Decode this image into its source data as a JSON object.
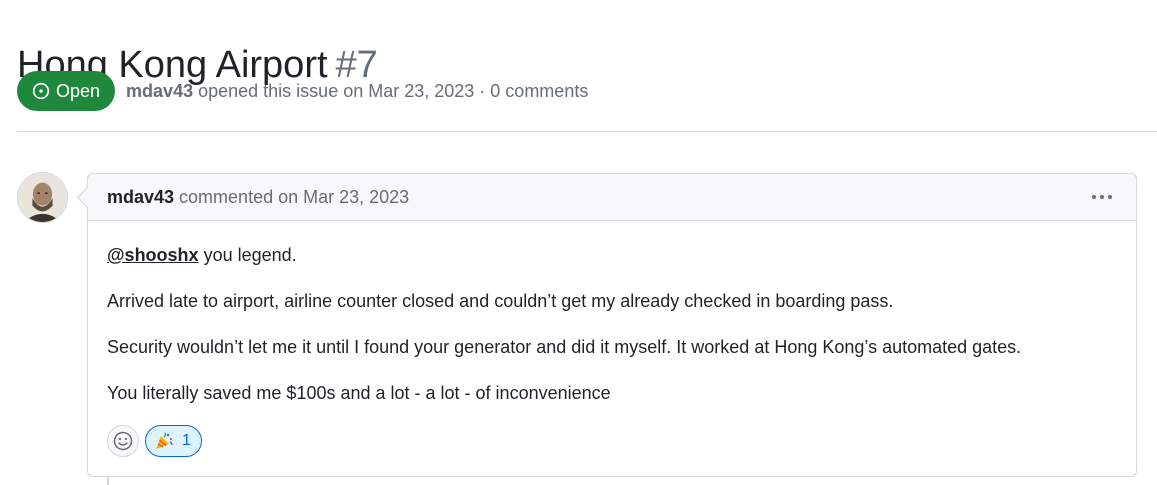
{
  "issue": {
    "title": "Hong Kong Airport",
    "number": "#7",
    "state_label": "Open",
    "author": "mdav43",
    "meta_text": "opened this issue on Mar 23, 2023 · 0 comments"
  },
  "comment": {
    "author": "mdav43",
    "meta_text": "commented on Mar 23, 2023",
    "mention": "@shooshx",
    "line1_rest": " you legend.",
    "line2": "Arrived late to airport, airline counter closed and couldn’t get my already checked in boarding pass.",
    "line3": "Security wouldn’t let me it until I found your generator and did it myself. It worked at Hong Kong’s automated gates.",
    "line4": "You literally saved me $100s and a lot - a lot - of inconvenience",
    "reactions": [
      {
        "emoji": "tada",
        "count": "1"
      }
    ]
  },
  "icons": {
    "state": "issue-opened-icon",
    "more": "kebab-horizontal-icon",
    "add_reaction": "smiley-icon",
    "reaction": "tada-icon"
  },
  "colors": {
    "open_green": "#1f883d",
    "reaction_blue": "#0969da",
    "reaction_bg": "#ddf4ff",
    "muted_text": "#656d76",
    "border": "#d0d7de"
  }
}
